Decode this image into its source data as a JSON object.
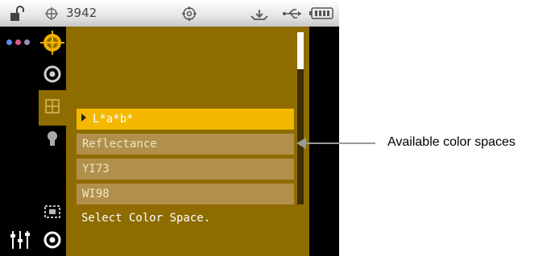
{
  "status_bar": {
    "count": "3942",
    "icons": [
      "lock-open-icon",
      "crosshair-icon",
      "target-icon",
      "tray-icon",
      "usb-icon",
      "battery-icon"
    ]
  },
  "tabs": [
    {
      "icon": "target-icon",
      "active": false
    },
    {
      "icon": "ring-icon",
      "active": false
    },
    {
      "icon": "grid-icon",
      "active": true
    },
    {
      "icon": "bulb-icon",
      "active": false
    },
    {
      "icon": "dashed-square-icon",
      "active": false
    },
    {
      "icon": "ring-icon",
      "active": false
    }
  ],
  "color_spaces": [
    {
      "label": "L*a*b*",
      "selected": true
    },
    {
      "label": "Reflectance",
      "selected": false
    },
    {
      "label": "YI73",
      "selected": false
    },
    {
      "label": "WI98",
      "selected": false
    }
  ],
  "hint": "Select Color Space.",
  "callout": "Available color spaces",
  "colors": {
    "panel": "#8e6c00",
    "selected": "#f4b800",
    "option": "#b0904a",
    "accent_target": "#e8a800"
  }
}
